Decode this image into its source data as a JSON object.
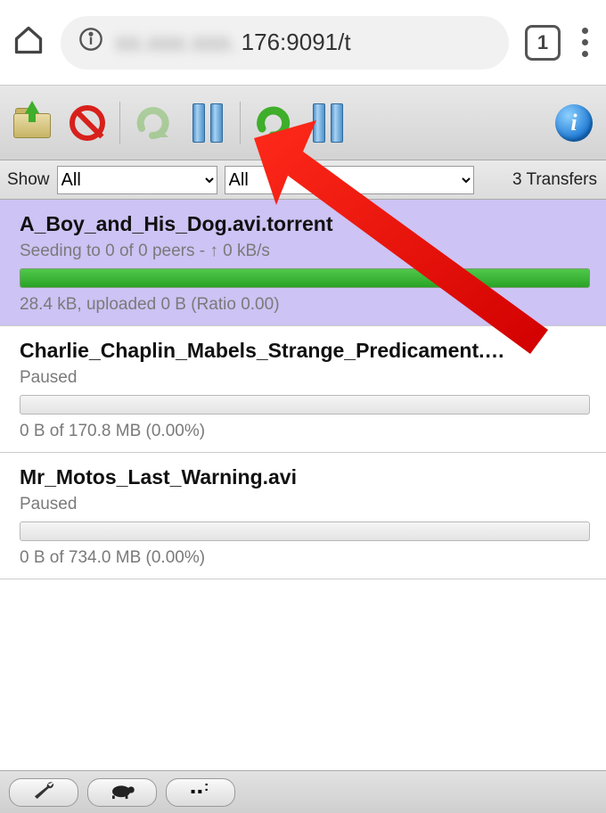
{
  "browser": {
    "url_blurred": "xx.xxx.xxx.",
    "url_visible": "176:9091/t",
    "tab_count": "1"
  },
  "filter": {
    "show_label": "Show",
    "status_value": "All",
    "tracker_value": "All",
    "count_label": "3 Transfers"
  },
  "torrents": [
    {
      "title": "A_Boy_and_His_Dog.avi.torrent",
      "status": "Seeding to 0 of 0 peers - ↑ 0 kB/s",
      "progress_pct": 100,
      "footer": "28.4 kB, uploaded 0 B (Ratio 0.00)",
      "selected": true
    },
    {
      "title": "Charlie_Chaplin_Mabels_Strange_Predicament.…",
      "status": "Paused",
      "progress_pct": 0,
      "footer": "0 B of 170.8 MB (0.00%)",
      "selected": false
    },
    {
      "title": "Mr_Motos_Last_Warning.avi",
      "status": "Paused",
      "progress_pct": 0,
      "footer": "0 B of 734.0 MB (0.00%)",
      "selected": false
    }
  ]
}
